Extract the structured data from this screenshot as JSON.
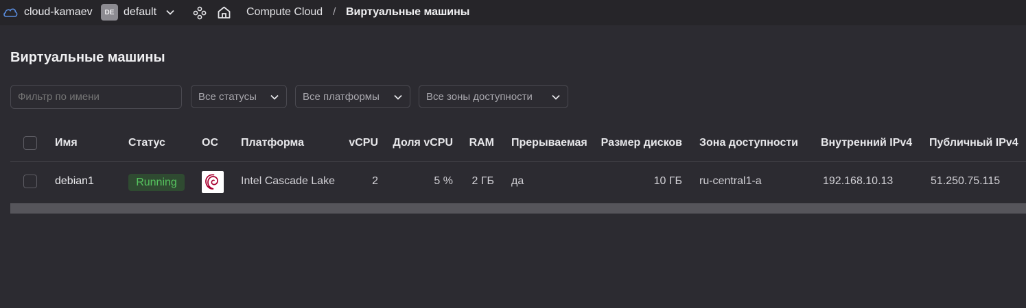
{
  "header": {
    "cloud_name": "cloud-kamaev",
    "folder_badge": "DE",
    "folder_name": "default",
    "breadcrumb_service": "Compute Cloud",
    "breadcrumb_separator": "/",
    "breadcrumb_current": "Виртуальные машины",
    "icons": [
      "cloud-icon",
      "chevron-down-icon",
      "services-icon",
      "home-icon"
    ]
  },
  "page": {
    "title": "Виртуальные машины"
  },
  "filters": {
    "name_placeholder": "Фильтр по имени",
    "status": "Все статусы",
    "platform": "Все платформы",
    "zone": "Все зоны доступности"
  },
  "table": {
    "columns": [
      "Имя",
      "Статус",
      "ОС",
      "Платформа",
      "vCPU",
      "Доля vCPU",
      "RAM",
      "Прерываемая",
      "Размер дисков",
      "Зона доступности",
      "Внутренний IPv4",
      "Публичный IPv4"
    ],
    "rows": [
      {
        "name": "debian1",
        "status": "Running",
        "os_icon": "debian-logo-icon",
        "platform": "Intel Cascade Lake",
        "vcpu": "2",
        "vcpu_share": "5 %",
        "ram": "2 ГБ",
        "preemptible": "да",
        "disk_size": "10 ГБ",
        "zone": "ru-central1-a",
        "internal_ipv4": "192.168.10.13",
        "public_ipv4": "51.250.75.115"
      }
    ]
  },
  "colors": {
    "background": "#2c2b31",
    "topbar": "#262529",
    "status_running_text": "#56c45f",
    "status_running_bg": "#2f4a31",
    "debian_red": "#a80030"
  }
}
